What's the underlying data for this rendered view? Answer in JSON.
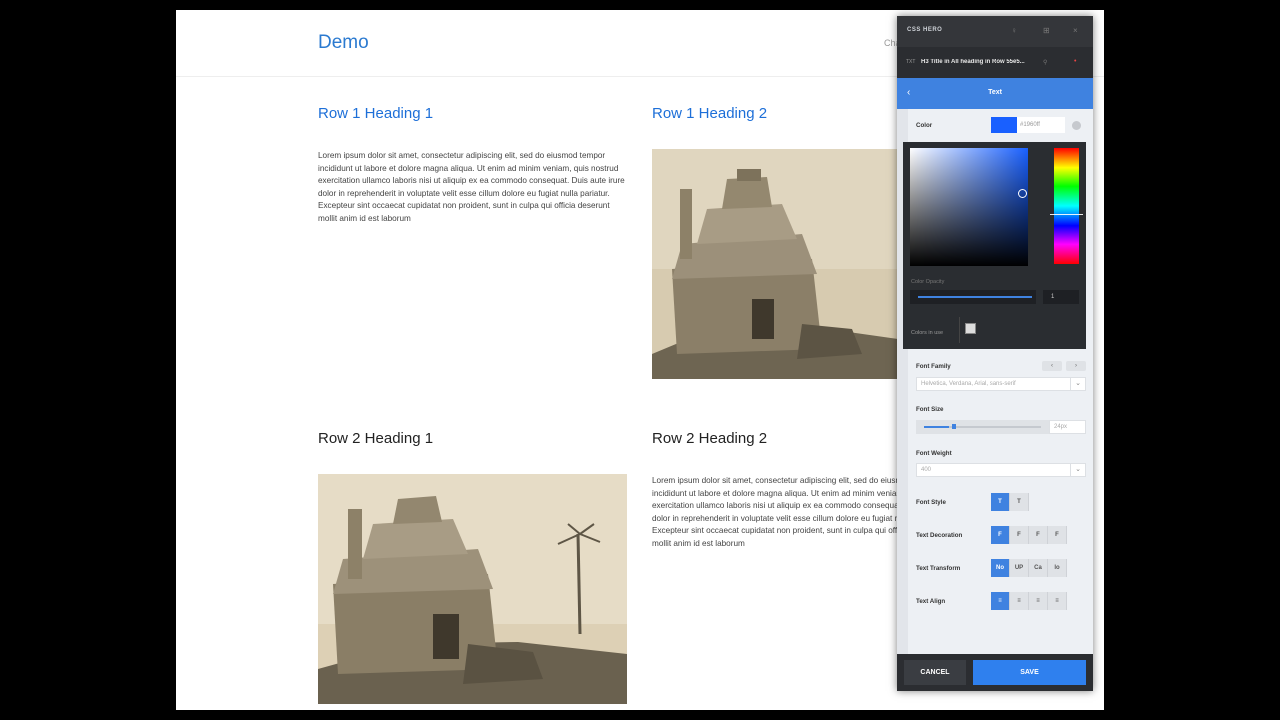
{
  "site": {
    "title": "Demo",
    "nav_partial": "Cha"
  },
  "content": {
    "row1": {
      "heading1": "Row 1 Heading 1",
      "text1": "Lorem ipsum dolor sit amet, consectetur adipiscing elit, sed do eiusmod tempor incididunt ut labore et dolore magna aliqua. Ut enim ad minim veniam, quis nostrud exercitation ullamco laboris nisi ut aliquip ex ea commodo consequat. Duis aute irure dolor in reprehenderit in voluptate velit esse cillum dolore eu fugiat nulla pariatur. Excepteur sint occaecat cupidatat non proident, sunt in culpa qui officia deserunt mollit anim id est laborum",
      "heading2": "Row 1 Heading 2"
    },
    "row2": {
      "heading1": "Row 2 Heading 1",
      "heading2": "Row 2 Heading 2",
      "text2": "Lorem ipsum dolor sit amet, consectetur adipiscing elit, sed do eiusmod tempor incididunt ut labore et dolore magna aliqua. Ut enim ad minim veniam, quis nostrud exercitation ullamco laboris nisi ut aliquip ex ea commodo consequat. Duis aute irure dolor in reprehenderit in voluptate velit esse cillum dolore eu fugiat nulla pariatur. Excepteur sint occaecat cupidatat non proident, sunt in culpa qui officia deserunt mollit anim id est laborum"
    }
  },
  "panel": {
    "brand": "CSS HERO",
    "selected": "H3 Title in All heading in Row 55e5...",
    "section_title": "Text",
    "color": {
      "label": "Color",
      "value": "#1960ff",
      "swatch": "#1960ff"
    },
    "picker": {
      "opacity_label": "Color Opacity",
      "opacity_value": "1",
      "in_use_label": "Colors in use"
    },
    "font_family": {
      "label": "Font Family",
      "value": "Helvetica, Verdana, Arial, sans-serif"
    },
    "font_size": {
      "label": "Font Size",
      "value": "24px"
    },
    "font_weight": {
      "label": "Font Weight",
      "value": "400"
    },
    "font_style": {
      "label": "Font Style",
      "options": [
        "T",
        "T"
      ]
    },
    "text_decoration": {
      "label": "Text Decoration",
      "options": [
        "F",
        "F",
        "F",
        "F"
      ]
    },
    "text_transform": {
      "label": "Text Transform",
      "options": [
        "No",
        "UP",
        "Ca",
        "lo"
      ]
    },
    "text_align": {
      "label": "Text Align",
      "options": [
        "≡",
        "≡",
        "≡",
        "≡"
      ]
    },
    "cancel": "CANCEL",
    "save": "SAVE"
  }
}
